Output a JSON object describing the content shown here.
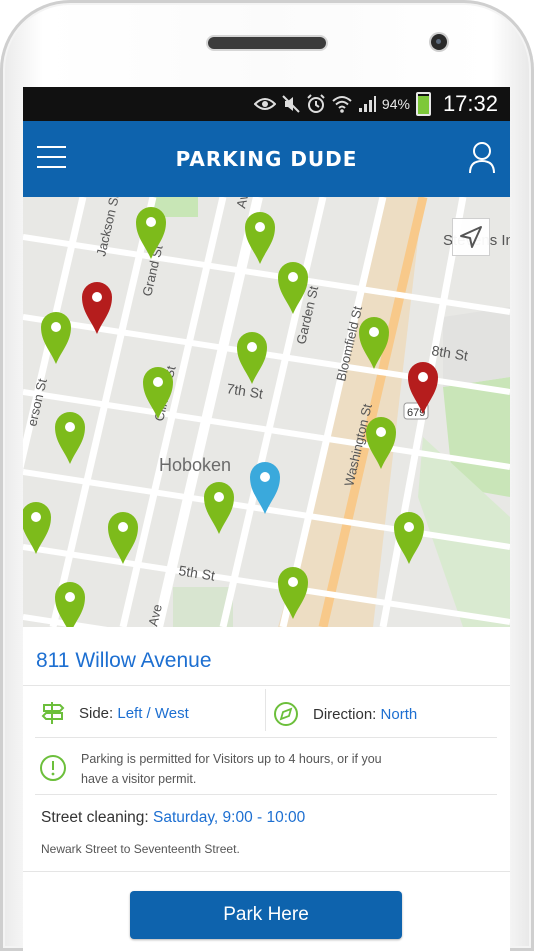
{
  "status": {
    "battery": "94%",
    "time": "17:32"
  },
  "app": {
    "title": "PARKING DUDE"
  },
  "map": {
    "streets": [
      "Jackson St",
      "Grand St",
      "Clinton St",
      "Garden St",
      "Bloomfield St",
      "Washington St",
      "7th St",
      "5th St",
      "8th St",
      "erson St",
      "Ave",
      "Ave"
    ],
    "places": [
      "Hoboken",
      "Stevens Institute of Technology"
    ],
    "route_badge": "679"
  },
  "detail": {
    "address": "811 Willow Avenue",
    "side_label": "Side:",
    "side_value": "Left / West",
    "direction_label": "Direction:",
    "direction_value": "North",
    "notice": "Parking is permitted for Visitors up to 4 hours, or if you have a visitor permit.",
    "cleaning_label": "Street cleaning:",
    "cleaning_value": "Saturday, 9:00 - 10:00",
    "cleaning_scope": "Newark Street to Seventeenth Street.",
    "park_button": "Park Here"
  },
  "colors": {
    "primary": "#0e63ad",
    "link": "#1d6fd1",
    "pin_green": "#7dbb1b",
    "pin_red": "#b51d1d",
    "pin_blue": "#3aa9dc"
  }
}
